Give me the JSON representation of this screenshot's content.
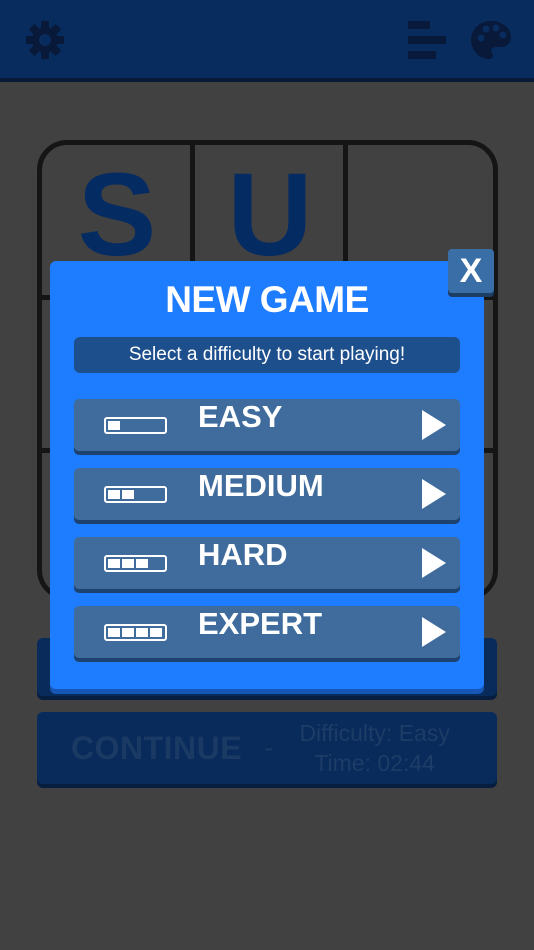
{
  "topbar": {
    "left_icons": [
      "gear-icon"
    ],
    "right_icons": [
      "leaderboard-icon",
      "palette-icon"
    ]
  },
  "board": {
    "letters": [
      "S",
      "U"
    ]
  },
  "continue_button": {
    "label": "CONTINUE",
    "separator": "-",
    "difficulty_text": "Difficulty: Easy",
    "time_text": "Time: 02:44"
  },
  "modal": {
    "close_label": "X",
    "title": "NEW GAME",
    "subtitle": "Select a difficulty to start playing!",
    "options": [
      {
        "label": "EASY",
        "level": 1,
        "icon": "difficulty-bar-icon"
      },
      {
        "label": "MEDIUM",
        "level": 2,
        "icon": "difficulty-bar-icon"
      },
      {
        "label": "HARD",
        "level": 3,
        "icon": "difficulty-bar-icon"
      },
      {
        "label": "EXPERT",
        "level": 4,
        "icon": "difficulty-bar-icon"
      }
    ]
  },
  "colors": {
    "modal_bg": "#1e7cff",
    "option_bg": "#3f6c9d",
    "topbar_bg": "#092c5e",
    "overlay_bg": "#414141"
  }
}
